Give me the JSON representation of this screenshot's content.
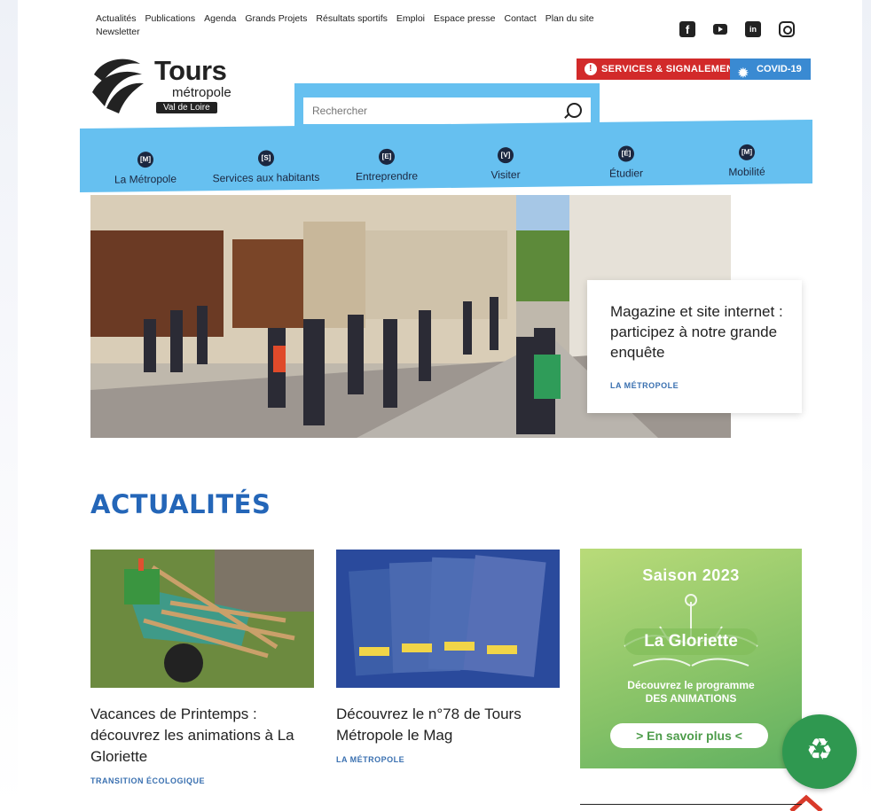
{
  "util_nav": {
    "items": [
      "Actualités",
      "Publications",
      "Agenda",
      "Grands Projets",
      "Résultats sportifs",
      "Emploi",
      "Espace presse",
      "Contact",
      "Plan du site",
      "Newsletter"
    ]
  },
  "social": [
    "facebook-icon",
    "youtube-icon",
    "linkedin-icon",
    "instagram-icon"
  ],
  "logo": {
    "word": "Tours",
    "sub": "métropole",
    "tag": "Val de Loire"
  },
  "buttons": {
    "services": "Services & Signalements",
    "covid": "Covid-19"
  },
  "search": {
    "placeholder": "Rechercher"
  },
  "main_nav": [
    {
      "badge": "[M]",
      "label": "La Métropole"
    },
    {
      "badge": "[S]",
      "label": "Services aux habitants"
    },
    {
      "badge": "[E]",
      "label": "Entreprendre"
    },
    {
      "badge": "[V]",
      "label": "Visiter"
    },
    {
      "badge": "[É]",
      "label": "Étudier"
    },
    {
      "badge": "[M]",
      "label": "Mobilité"
    }
  ],
  "hero": {
    "title": "Magazine et site internet : participez à notre grande enquête",
    "category": "La Métropole"
  },
  "actualites": {
    "title": "ACTUALITÉS",
    "cards": [
      {
        "title": "Vacances de Printemps : découvrez les animations à La Gloriette",
        "category": "Transition écologique"
      },
      {
        "title": "Découvrez le n°78 de Tours Métropole le Mag",
        "category": "La Métropole"
      }
    ],
    "promo": {
      "season": "Saison 2023",
      "brand": "La Gloriette",
      "line1": "Découvrez le programme",
      "line2": "des animations",
      "cta": "> En savoir plus <"
    }
  },
  "colors": {
    "accent_blue": "#66c0f0",
    "title_blue": "#2466b8",
    "services_red": "#d22a2a",
    "covid_blue": "#3a8ad2",
    "green": "#2f9850"
  }
}
